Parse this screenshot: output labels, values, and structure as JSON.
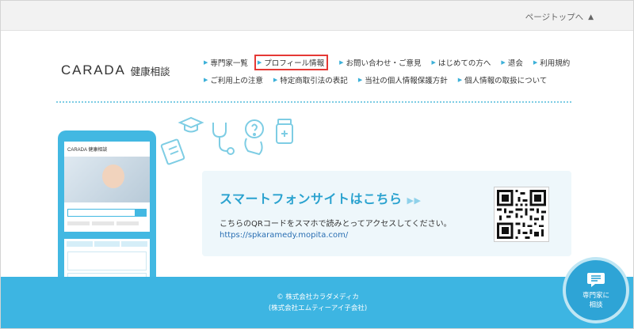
{
  "header": {
    "page_top_label": "ページトップへ",
    "page_top_icon": "triangle-up-icon"
  },
  "logo": {
    "brand": "CARADA",
    "sub": "健康相談"
  },
  "nav": {
    "row1": [
      {
        "label": "専門家一覧"
      },
      {
        "label": "プロフィール情報",
        "highlighted": true
      },
      {
        "label": "お問い合わせ・ご意見"
      },
      {
        "label": "はじめての方へ"
      },
      {
        "label": "退会"
      },
      {
        "label": "利用規約"
      }
    ],
    "row2": [
      {
        "label": "ご利用上の注意"
      },
      {
        "label": "特定商取引法の表記"
      },
      {
        "label": "当社の個人情報保護方針"
      },
      {
        "label": "個人情報の取扱について"
      }
    ]
  },
  "phone_mock": {
    "logo": "CARADA 健康相談"
  },
  "smartphone": {
    "title": "スマートフォンサイトはこちら",
    "description": "こちらのQRコードをスマホで読みとってアクセスしてください。",
    "url": "https://spkaramedy.mopita.com/"
  },
  "footer": {
    "copyright": "© 株式会社カラダメディカ",
    "company": "(株式会社エムティーアイ子会社)"
  },
  "fab": {
    "line1": "専門家に",
    "line2": "相談"
  },
  "colors": {
    "accent": "#3db5e2",
    "highlight_border": "#e53935",
    "link": "#2a6fb3"
  }
}
